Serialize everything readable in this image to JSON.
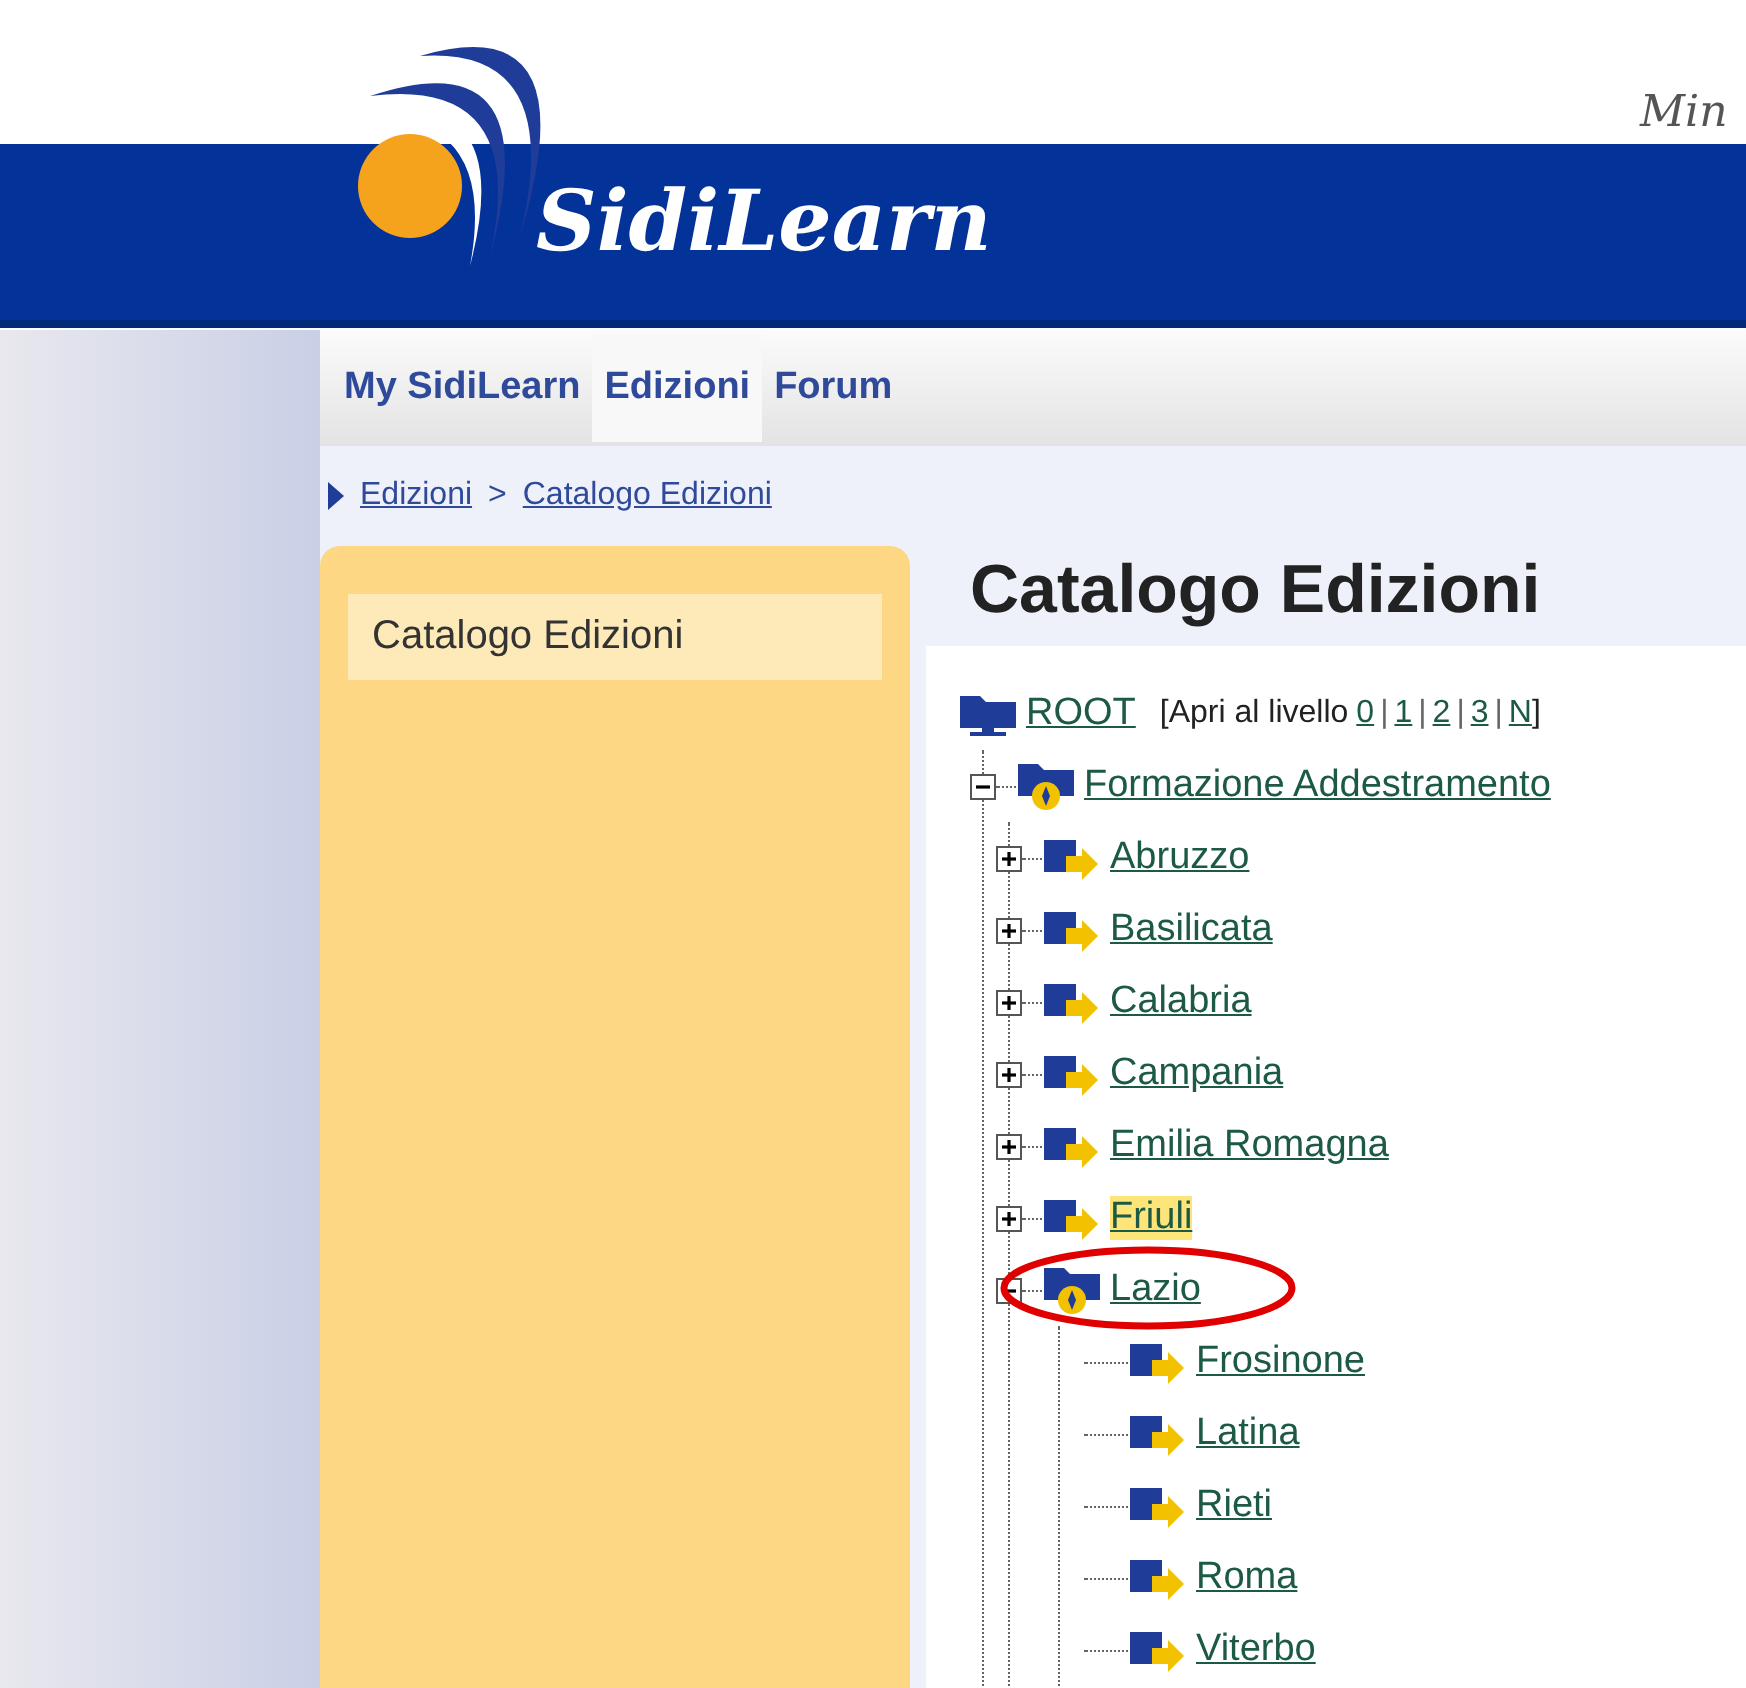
{
  "header": {
    "logo": "SidiLearn",
    "ministry_text": "Min"
  },
  "nav": {
    "tabs": [
      {
        "label": "My SidiLearn",
        "selected": false
      },
      {
        "label": "Edizioni",
        "selected": true
      },
      {
        "label": "Forum",
        "selected": false
      }
    ]
  },
  "breadcrumb": {
    "items": [
      "Edizioni",
      "Catalogo Edizioni"
    ],
    "separator": ">"
  },
  "sidebar": {
    "items": [
      {
        "label": "Catalogo Edizioni",
        "selected": true
      }
    ]
  },
  "page_title": "Catalogo Edizioni",
  "tree": {
    "root": {
      "label": "ROOT",
      "level_prefix": "[Apri al livello",
      "level_links": [
        "0",
        "1",
        "2",
        "3",
        "N"
      ],
      "separator": "|",
      "level_suffix": "]"
    },
    "items": [
      {
        "label": "Formazione Addestramento",
        "kind": "folder",
        "expanded": true,
        "selected": false,
        "children": [
          {
            "label": "Abruzzo",
            "kind": "folder",
            "expanded": false,
            "selected": false,
            "circled": false
          },
          {
            "label": "Basilicata",
            "kind": "folder",
            "expanded": false,
            "selected": false,
            "circled": false
          },
          {
            "label": "Calabria",
            "kind": "folder",
            "expanded": false,
            "selected": false,
            "circled": false
          },
          {
            "label": "Campania",
            "kind": "folder",
            "expanded": false,
            "selected": false,
            "circled": false
          },
          {
            "label": "Emilia Romagna",
            "kind": "folder",
            "expanded": false,
            "selected": false,
            "circled": false
          },
          {
            "label": "Friuli",
            "kind": "folder",
            "expanded": false,
            "selected": true,
            "circled": false
          },
          {
            "label": "Lazio",
            "kind": "folder",
            "expanded": true,
            "selected": false,
            "circled": true,
            "children": [
              {
                "label": "Frosinone",
                "selected": false
              },
              {
                "label": "Latina",
                "selected": false
              },
              {
                "label": "Rieti",
                "selected": false
              },
              {
                "label": "Roma",
                "selected": false
              },
              {
                "label": "Viterbo",
                "selected": false
              }
            ]
          }
        ]
      }
    ]
  }
}
